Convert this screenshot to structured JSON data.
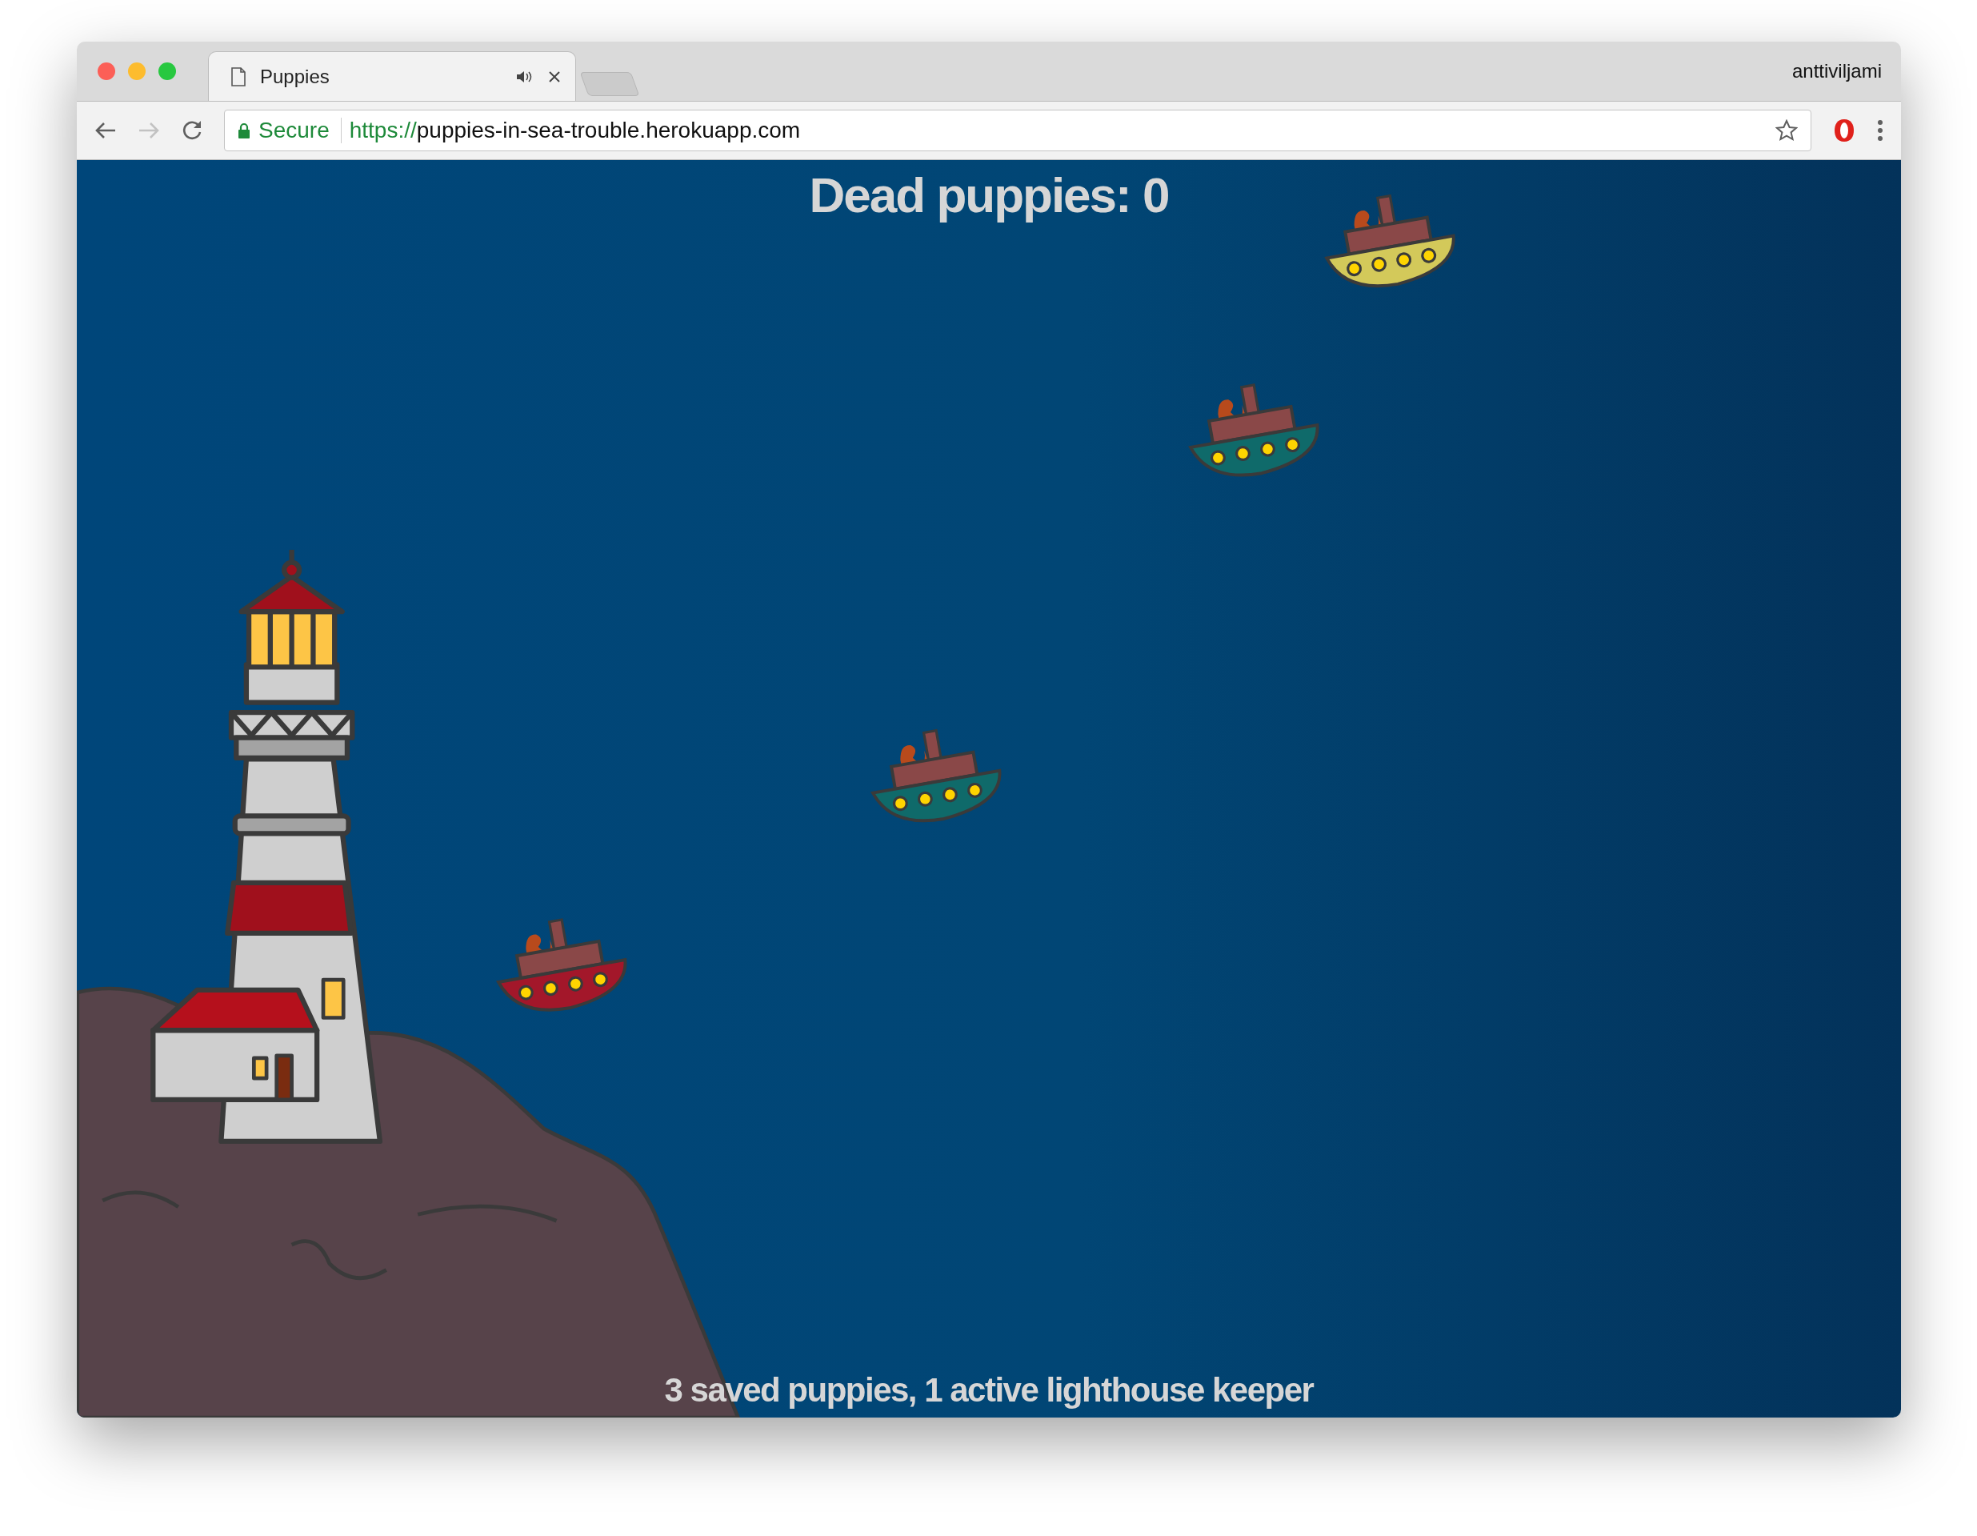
{
  "browser": {
    "tab": {
      "title": "Puppies"
    },
    "profile": "anttiviljami",
    "address": {
      "security": "Secure",
      "scheme": "https://",
      "host": "puppies-in-sea-trouble.herokuapp.com"
    }
  },
  "game": {
    "dead_counter": "Dead puppies: 0",
    "boats": [
      {
        "color": "#d3c95a"
      },
      {
        "color": "#0f6a6a"
      },
      {
        "color": "#0f6a6a"
      },
      {
        "color": "#a3172a"
      }
    ],
    "status": "3 saved puppies, 1 active lighthouse keeper"
  }
}
